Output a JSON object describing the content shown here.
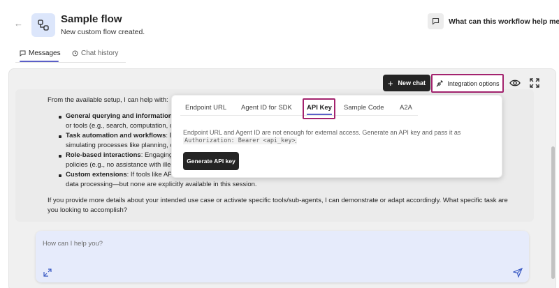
{
  "header": {
    "title": "Sample flow",
    "subtitle": "New custom flow created.",
    "ask_label": "What can this workflow help me do?"
  },
  "tabs": [
    {
      "label": "Messages",
      "active": true
    },
    {
      "label": "Chat history",
      "active": false
    }
  ],
  "toolbar": {
    "new_chat_label": "New chat",
    "integration_label": "Integration options"
  },
  "message": {
    "intro": "From the available setup, I can help with:",
    "bullets": [
      {
        "title": "General querying and information",
        "lines": [
          "or tools (e.g., search, computation, o"
        ]
      },
      {
        "title": "Task automation and workflows",
        "title_suffix": ": B",
        "lines": [
          "simulating processes like planning, d"
        ]
      },
      {
        "title": "Role-based interactions",
        "title_suffix": ": Engaging",
        "lines": [
          "policies (e.g., no assistance with illeg"
        ]
      },
      {
        "title": "Custom extensions",
        "title_suffix": ": If tools like API",
        "lines": [
          "data processing—but none are explicitly available in this session."
        ]
      }
    ],
    "closing_1": "If you provide more details about your intended use case or activate specific tools/sub-agents, I can demonstrate or adapt accordingly. What specific task are",
    "closing_2": "you looking to accomplish?"
  },
  "popup": {
    "tabs": [
      "Endpoint URL",
      "Agent ID for SDK",
      "API Key",
      "Sample Code",
      "A2A"
    ],
    "active_tab": "API Key",
    "description": "Endpoint URL and Agent ID are not enough for external access. Generate an API key and pass it as",
    "code": "Authorization: Bearer <api_key>",
    "code_suffix": ".",
    "button_label": "Generate API key"
  },
  "input": {
    "placeholder": "How can I help you?"
  },
  "colors": {
    "accent": "#5b5fc7",
    "highlight": "#a3236e",
    "dark_button": "#242424",
    "input_bg": "#e6ebfb"
  }
}
